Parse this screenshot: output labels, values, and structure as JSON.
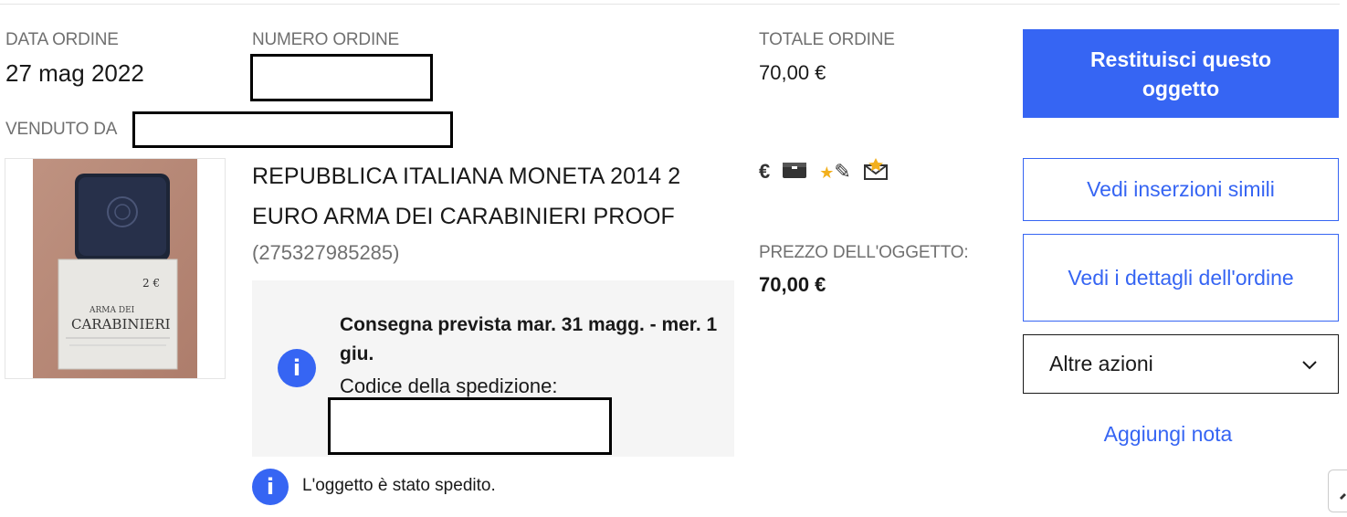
{
  "order": {
    "date_label": "DATA ORDINE",
    "date_value": "27 mag 2022",
    "number_label": "NUMERO ORDINE",
    "total_label": "TOTALE ORDINE",
    "total_value": "70,00 €",
    "sold_by_label": "VENDUTO DA"
  },
  "item": {
    "title": "REPUBBLICA ITALIANA MONETA 2014 2 EURO ARMA DEI CARABINIERI PROOF",
    "number": "(275327985285)",
    "price_label": "PREZZO DELL'OGGETTO:",
    "price_value": "70,00 €",
    "image_text_top": "2 €",
    "image_text_mid": "ARMA DEI",
    "image_text_main": "CARABINIERI"
  },
  "status_icons": [
    "euro-icon",
    "package-icon",
    "feedback-star-icon",
    "message-icon"
  ],
  "status_icon_glyphs": {
    "euro": "€",
    "package": "▬",
    "star": "★",
    "pen": "✎",
    "mail": "✉"
  },
  "delivery": {
    "title": "Consegna prevista mar. 31 magg. - mer. 1 giu.",
    "code_label": "Codice della spedizione:",
    "info_glyph": "i"
  },
  "shipped_note": {
    "text": "L'oggetto è stato spedito.",
    "info_glyph": "i"
  },
  "actions": {
    "return_label": "Restituisci questo oggetto",
    "similar_label": "Vedi inserzioni simili",
    "details_label": "Vedi i dettagli dell'ordine",
    "more_label": "Altre azioni",
    "add_note_label": "Aggiungi nota"
  },
  "colors": {
    "primary": "#3665f3",
    "text": "#191919",
    "muted": "#707070",
    "box": "#f5f5f5"
  }
}
